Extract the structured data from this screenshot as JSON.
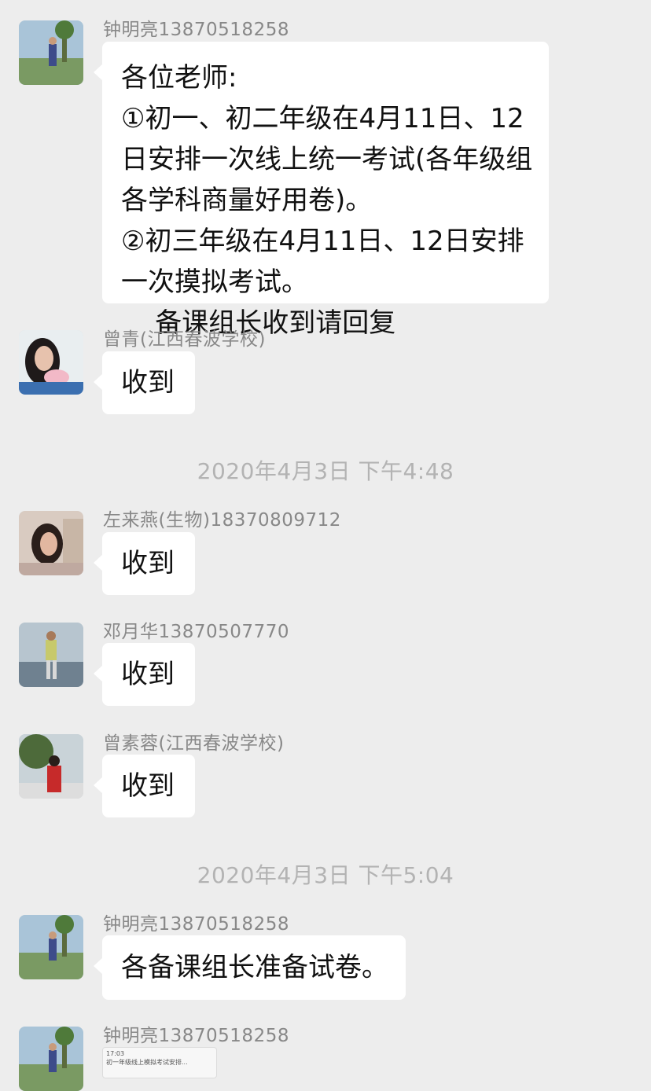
{
  "messages": [
    {
      "sender": "钟明亮13870518258",
      "text": "各位老师:\n①初一、初二年级在4月11日、12日安排一次线上统一考试(各年级组各学科商量好用卷)。\n②初三年级在4月11日、12日安排一次摸拟考试。\n    备课组长收到请回复"
    },
    {
      "sender": "曾青(江西春波学校)",
      "text": "收到"
    },
    {
      "sender": "左来燕(生物)18370809712",
      "text": "收到"
    },
    {
      "sender": "邓月华13870507770",
      "text": "收到"
    },
    {
      "sender": "曾素蓉(江西春波学校)",
      "text": "收到"
    },
    {
      "sender": "钟明亮13870518258",
      "text": "各备课组长准备试卷。"
    },
    {
      "sender": "钟明亮13870518258",
      "attachment": {
        "time": "17:03",
        "title": "初一年级线上模拟考试安排..."
      }
    }
  ],
  "timestamps": [
    "2020年4月3日 下午4:48",
    "2020年4月3日 下午5:04"
  ],
  "colors": {
    "background": "#ededed",
    "bubble": "#ffffff",
    "name": "#888888",
    "timestamp": "#b3b3b3"
  }
}
